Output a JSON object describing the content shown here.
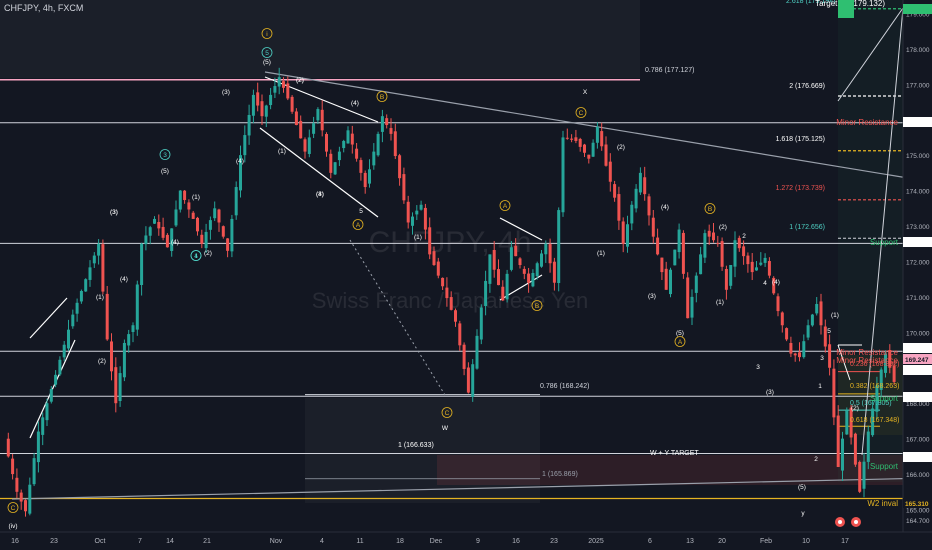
{
  "header": {
    "symbol_line": "CHFJPY, 4h, FXCM"
  },
  "watermark": {
    "symbol": "CHFJPY, 4h",
    "name": "Swiss Franc / Japanese Yen"
  },
  "colors": {
    "background": "#131722",
    "up": "#26a69a",
    "down": "#ef5350",
    "white": "#d1d4dc",
    "accent": "#e5b422",
    "cyan": "#4fd1c5",
    "pink": "#f8a5c2",
    "red": "#ef5350",
    "green": "#2fbf71"
  },
  "chart_data": {
    "type": "candlestick",
    "symbol": "CHFJPY",
    "timeframe": "4h",
    "ylim": [
      164.45,
      179.35
    ],
    "x_tick_labels": [
      "16",
      "23",
      "Oct",
      "7",
      "14",
      "21",
      "Nov",
      "4",
      "11",
      "18",
      "Dec",
      "9",
      "16",
      "23",
      "2025",
      "6",
      "13",
      "20",
      "Feb",
      "10",
      "17"
    ],
    "y_tick_labels": [
      "179.000",
      "178.000",
      "177.000",
      "176.000",
      "175.000",
      "174.000",
      "173.000",
      "172.000",
      "171.000",
      "170.000",
      "169.000",
      "168.000",
      "167.000",
      "166.000",
      "165.000",
      "164.700"
    ],
    "price_path": [
      [
        0,
        167.0
      ],
      [
        3,
        165.5
      ],
      [
        5,
        164.95
      ],
      [
        8,
        167.2
      ],
      [
        12,
        168.8
      ],
      [
        16,
        170.5
      ],
      [
        19,
        171.5
      ],
      [
        22,
        172.5
      ],
      [
        24,
        169.8
      ],
      [
        26,
        168.0
      ],
      [
        28,
        169.7
      ],
      [
        30,
        170.2
      ],
      [
        32,
        172.5
      ],
      [
        35,
        173.2
      ],
      [
        38,
        172.4
      ],
      [
        41,
        174.0
      ],
      [
        44,
        173.2
      ],
      [
        46,
        172.5
      ],
      [
        49,
        173.5
      ],
      [
        52,
        172.3
      ],
      [
        55,
        175.0
      ],
      [
        58,
        176.7
      ],
      [
        60,
        176.1
      ],
      [
        62,
        176.7
      ],
      [
        64,
        177.2
      ],
      [
        66,
        176.6
      ],
      [
        70,
        175.1
      ],
      [
        73,
        176.3
      ],
      [
        76,
        174.5
      ],
      [
        80,
        175.7
      ],
      [
        82,
        174.9
      ],
      [
        84,
        174.1
      ],
      [
        88,
        176.1
      ],
      [
        90,
        175.6
      ],
      [
        94,
        173.1
      ],
      [
        97,
        173.6
      ],
      [
        99,
        172.2
      ],
      [
        102,
        171.3
      ],
      [
        105,
        170.3
      ],
      [
        108,
        168.3
      ],
      [
        111,
        170.7
      ],
      [
        113,
        172.2
      ],
      [
        116,
        170.9
      ],
      [
        118,
        172.4
      ],
      [
        122,
        171.4
      ],
      [
        126,
        172.5
      ],
      [
        128,
        171.4
      ],
      [
        130,
        175.5
      ],
      [
        133,
        175.4
      ],
      [
        136,
        174.9
      ],
      [
        138,
        175.8
      ],
      [
        140,
        174.7
      ],
      [
        142,
        173.8
      ],
      [
        144,
        172.5
      ],
      [
        146,
        173.6
      ],
      [
        148,
        174.5
      ],
      [
        151,
        172.7
      ],
      [
        154,
        171.2
      ],
      [
        157,
        172.9
      ],
      [
        159,
        170.4
      ],
      [
        161,
        171.6
      ],
      [
        163,
        172.8
      ],
      [
        166,
        172.5
      ],
      [
        168,
        171.2
      ],
      [
        170,
        172.6
      ],
      [
        174,
        171.7
      ],
      [
        177,
        172.1
      ],
      [
        180,
        170.6
      ],
      [
        183,
        169.4
      ],
      [
        185,
        169.3
      ],
      [
        187,
        170.2
      ],
      [
        189,
        170.8
      ],
      [
        192,
        169.0
      ],
      [
        194,
        166.2
      ],
      [
        196,
        167.8
      ],
      [
        199,
        165.5
      ],
      [
        201,
        167.2
      ],
      [
        203,
        168.5
      ],
      [
        205,
        169.4
      ],
      [
        207,
        168.6
      ]
    ],
    "levels": [
      {
        "label": "0.786 (177.127)",
        "price": 177.127
      },
      {
        "label": "2 (176.669)",
        "price": 176.669
      },
      {
        "label": "1.618 (175.125)",
        "price": 175.125
      },
      {
        "label": "1.272 (173.739)",
        "price": 173.739
      },
      {
        "label": "1 (172.656)",
        "price": 172.656
      },
      {
        "label": "0.786 (168.242)",
        "price": 168.242
      },
      {
        "label": "0.236 (168.892)",
        "price": 168.892
      },
      {
        "label": "0.382 (168.263)",
        "price": 168.263
      },
      {
        "label": "0.5 (167.805)",
        "price": 167.805
      },
      {
        "label": "0.618 (167.348)",
        "price": 167.348
      },
      {
        "label": "1 (166.633)",
        "price": 166.633
      },
      {
        "label": "1 (165.869)",
        "price": 165.869
      },
      {
        "label": "W + Y TARGET",
        "price": 166.63
      }
    ],
    "line_tags": [
      {
        "label": "Minor Resistance",
        "price": 175.916
      },
      {
        "label": "Support",
        "price": 172.511
      },
      {
        "label": "Minor Resistance",
        "price": 169.466
      },
      {
        "label": "Minor Resistance",
        "price": 169.236
      },
      {
        "label": "Support",
        "price": 168.196
      },
      {
        "label": "Support",
        "price": 166.0
      },
      {
        "label": "W2 inval",
        "price": 165.31
      },
      {
        "label": "Target #1 (179.132)",
        "price": 179.132
      }
    ],
    "price_tags": [
      {
        "text": "179.132",
        "price": 179.132,
        "color": "#2fbf71"
      },
      {
        "text": "175.916",
        "price": 175.916,
        "color": "#ffffff"
      },
      {
        "text": "172.511",
        "price": 172.511,
        "color": "#ffffff"
      },
      {
        "text": "169.466",
        "price": 169.466,
        "color": "#ffffff"
      },
      {
        "text": "169.247",
        "price": 169.247,
        "color": "#131722"
      },
      {
        "text": "169.236",
        "price": 169.236,
        "color": "#ffffff"
      },
      {
        "text": "168.196",
        "price": 168.196,
        "color": "#ffffff"
      },
      {
        "text": "166.579",
        "price": 166.579,
        "color": "#ffffff"
      },
      {
        "text": "165.310",
        "price": 165.31,
        "color": "#e5b422"
      }
    ],
    "extra_labels": [
      "2.618 (179.194)"
    ],
    "wave_labels": [
      "(iv)",
      "i",
      "5",
      "(5)",
      "(3)",
      "(4)",
      "(3)",
      "(4)",
      "(1)",
      "(2)",
      "3",
      "(5)",
      "(4)",
      "(3)",
      "(1)",
      "(2)",
      "1",
      "4",
      "(2)",
      "(2)",
      "(4)",
      "(1)",
      "B",
      "A",
      "C",
      "(1)",
      "(3)",
      "(4)",
      "5",
      "X",
      "C",
      "A",
      "B",
      "W",
      "C",
      "(2)",
      "(1)",
      "(4)",
      "B",
      "(3)",
      "(5)",
      "A",
      "(2)",
      "2",
      "(1)",
      "4",
      "(4)",
      "3",
      "(3)",
      "(5)",
      "y",
      "(1)",
      "(2)",
      "5",
      "3",
      "1",
      "2"
    ]
  }
}
